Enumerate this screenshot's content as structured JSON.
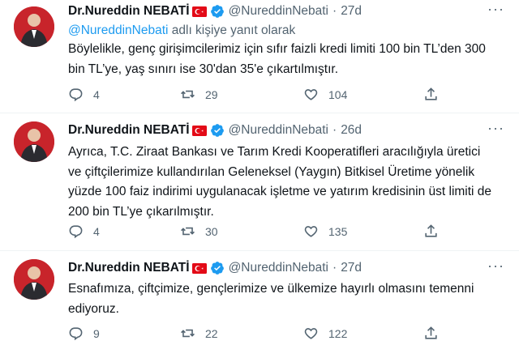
{
  "tweets": [
    {
      "author_name": "Dr.Nureddin NEBATİ",
      "handle": "@NureddinNebati",
      "separator": "·",
      "time": "27d",
      "reply_mention": "@NureddinNebati",
      "reply_suffix": " adlı kişiye yanıt olarak",
      "text_lines": [
        "Böylelikle, genç girişimcilerimiz için sıfır faizli kredi limiti 100 bin TL’den 300",
        "bin TL’ye, yaş sınırı ise 30'dan 35'e çıkartılmıştır."
      ],
      "replies": "4",
      "retweets": "29",
      "likes": "104"
    },
    {
      "author_name": "Dr.Nureddin NEBATİ",
      "handle": "@NureddinNebati",
      "separator": "·",
      "time": "26d",
      "text_lines": [
        "Ayrıca, T.C. Ziraat Bankası ve Tarım Kredi Kooperatifleri aracılığıyla üretici",
        "ve çiftçilerimize kullandırılan Geleneksel (Yaygın) Bitkisel Üretime yönelik",
        "yüzde 100 faiz indirimi uygulanacak işletme ve yatırım kredisinin üst limiti de",
        "200 bin TL’ye çıkarılmıştır."
      ],
      "replies": "4",
      "retweets": "30",
      "likes": "135"
    },
    {
      "author_name": "Dr.Nureddin NEBATİ",
      "handle": "@NureddinNebati",
      "separator": "·",
      "time": "27d",
      "text_lines": [
        "Esnafımıza, çiftçimize, gençlerimize ve ülkemize hayırlı olmasını temenni",
        "ediyoruz."
      ],
      "replies": "9",
      "retweets": "22",
      "likes": "122"
    }
  ],
  "colors": {
    "text": "#0f1419",
    "muted": "#536471",
    "accent": "#1d9bf0",
    "flag_red": "#e30a17"
  },
  "icons": [
    "avatar",
    "turkish-flag-icon",
    "verified-badge-icon",
    "more-options-icon",
    "reply-icon",
    "retweet-icon",
    "like-icon",
    "share-icon"
  ]
}
